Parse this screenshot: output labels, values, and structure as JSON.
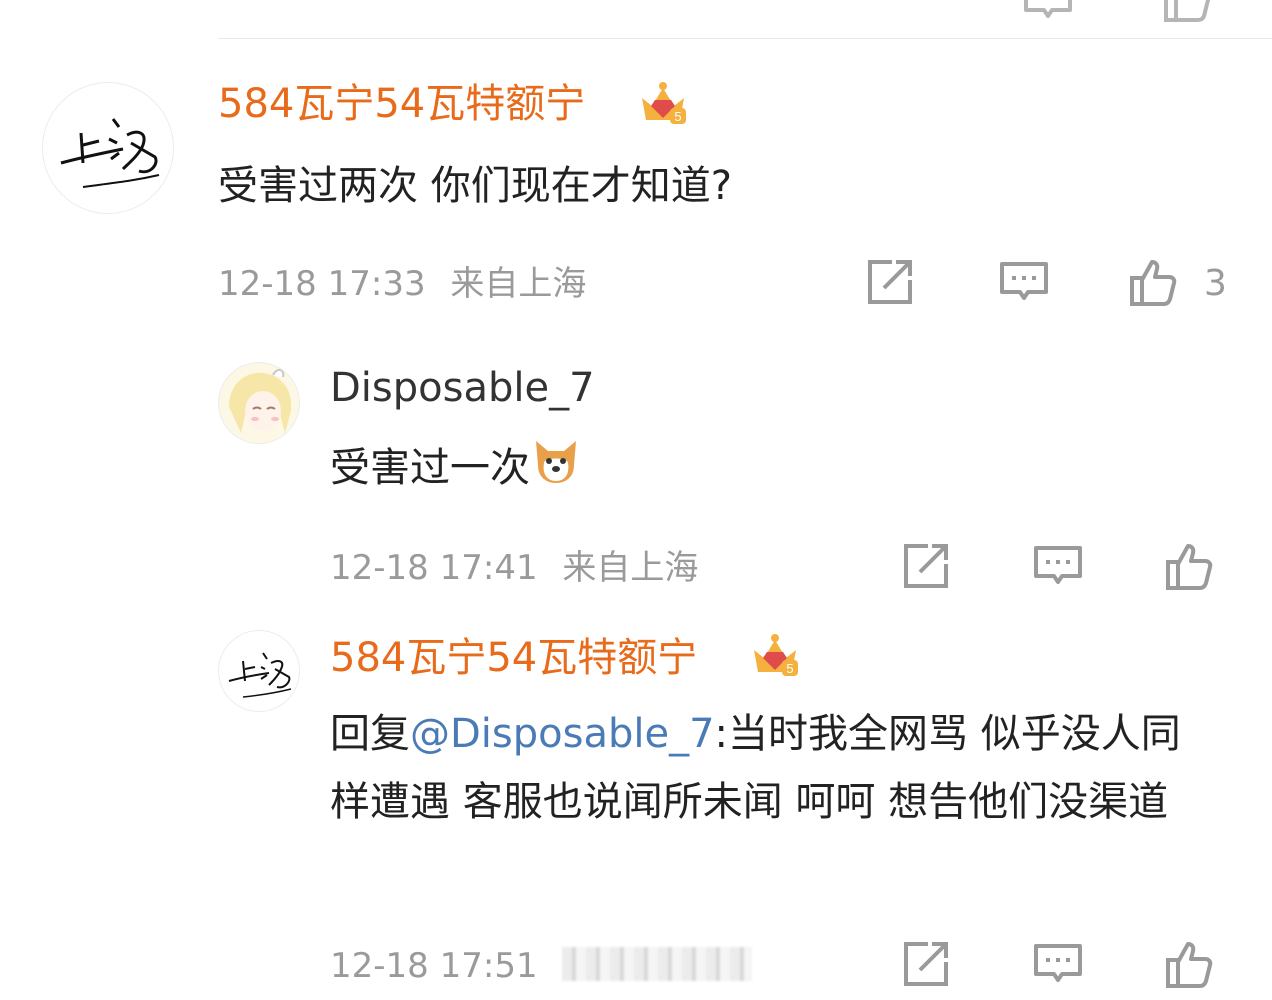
{
  "comments": [
    {
      "user": "584瓦宁54瓦特额宁",
      "text": "受害过两次 你们现在才知道?",
      "time": "12-18 17:33",
      "location": "来自上海",
      "likes": "3",
      "avatar_icon": "handwriting-avatar-icon",
      "badge_icon": "crown-level-5-icon"
    }
  ],
  "replies": [
    {
      "user": "Disposable_7",
      "text": "受害过一次",
      "time": "12-18 17:41",
      "location": "来自上海",
      "avatar_icon": "anime-girl-avatar-icon",
      "emoji_icon": "dog-emoji-icon"
    },
    {
      "user": "584瓦宁54瓦特额宁",
      "reply_prefix": "回复",
      "mention": "@Disposable_7",
      "text": ":当时我全网骂 似乎没人同样遭遇 客服也说闻所未闻 呵呵 想告他们没渠道",
      "time": "12-18 17:51",
      "avatar_icon": "handwriting-avatar-icon",
      "badge_icon": "crown-level-5-icon"
    }
  ],
  "icons": {
    "share": "share-icon",
    "comment": "comment-icon",
    "like": "thumbs-up-icon"
  },
  "colors": {
    "username": "#e86b1b",
    "mention": "#4b7bb6",
    "meta": "#9a9a9a"
  }
}
